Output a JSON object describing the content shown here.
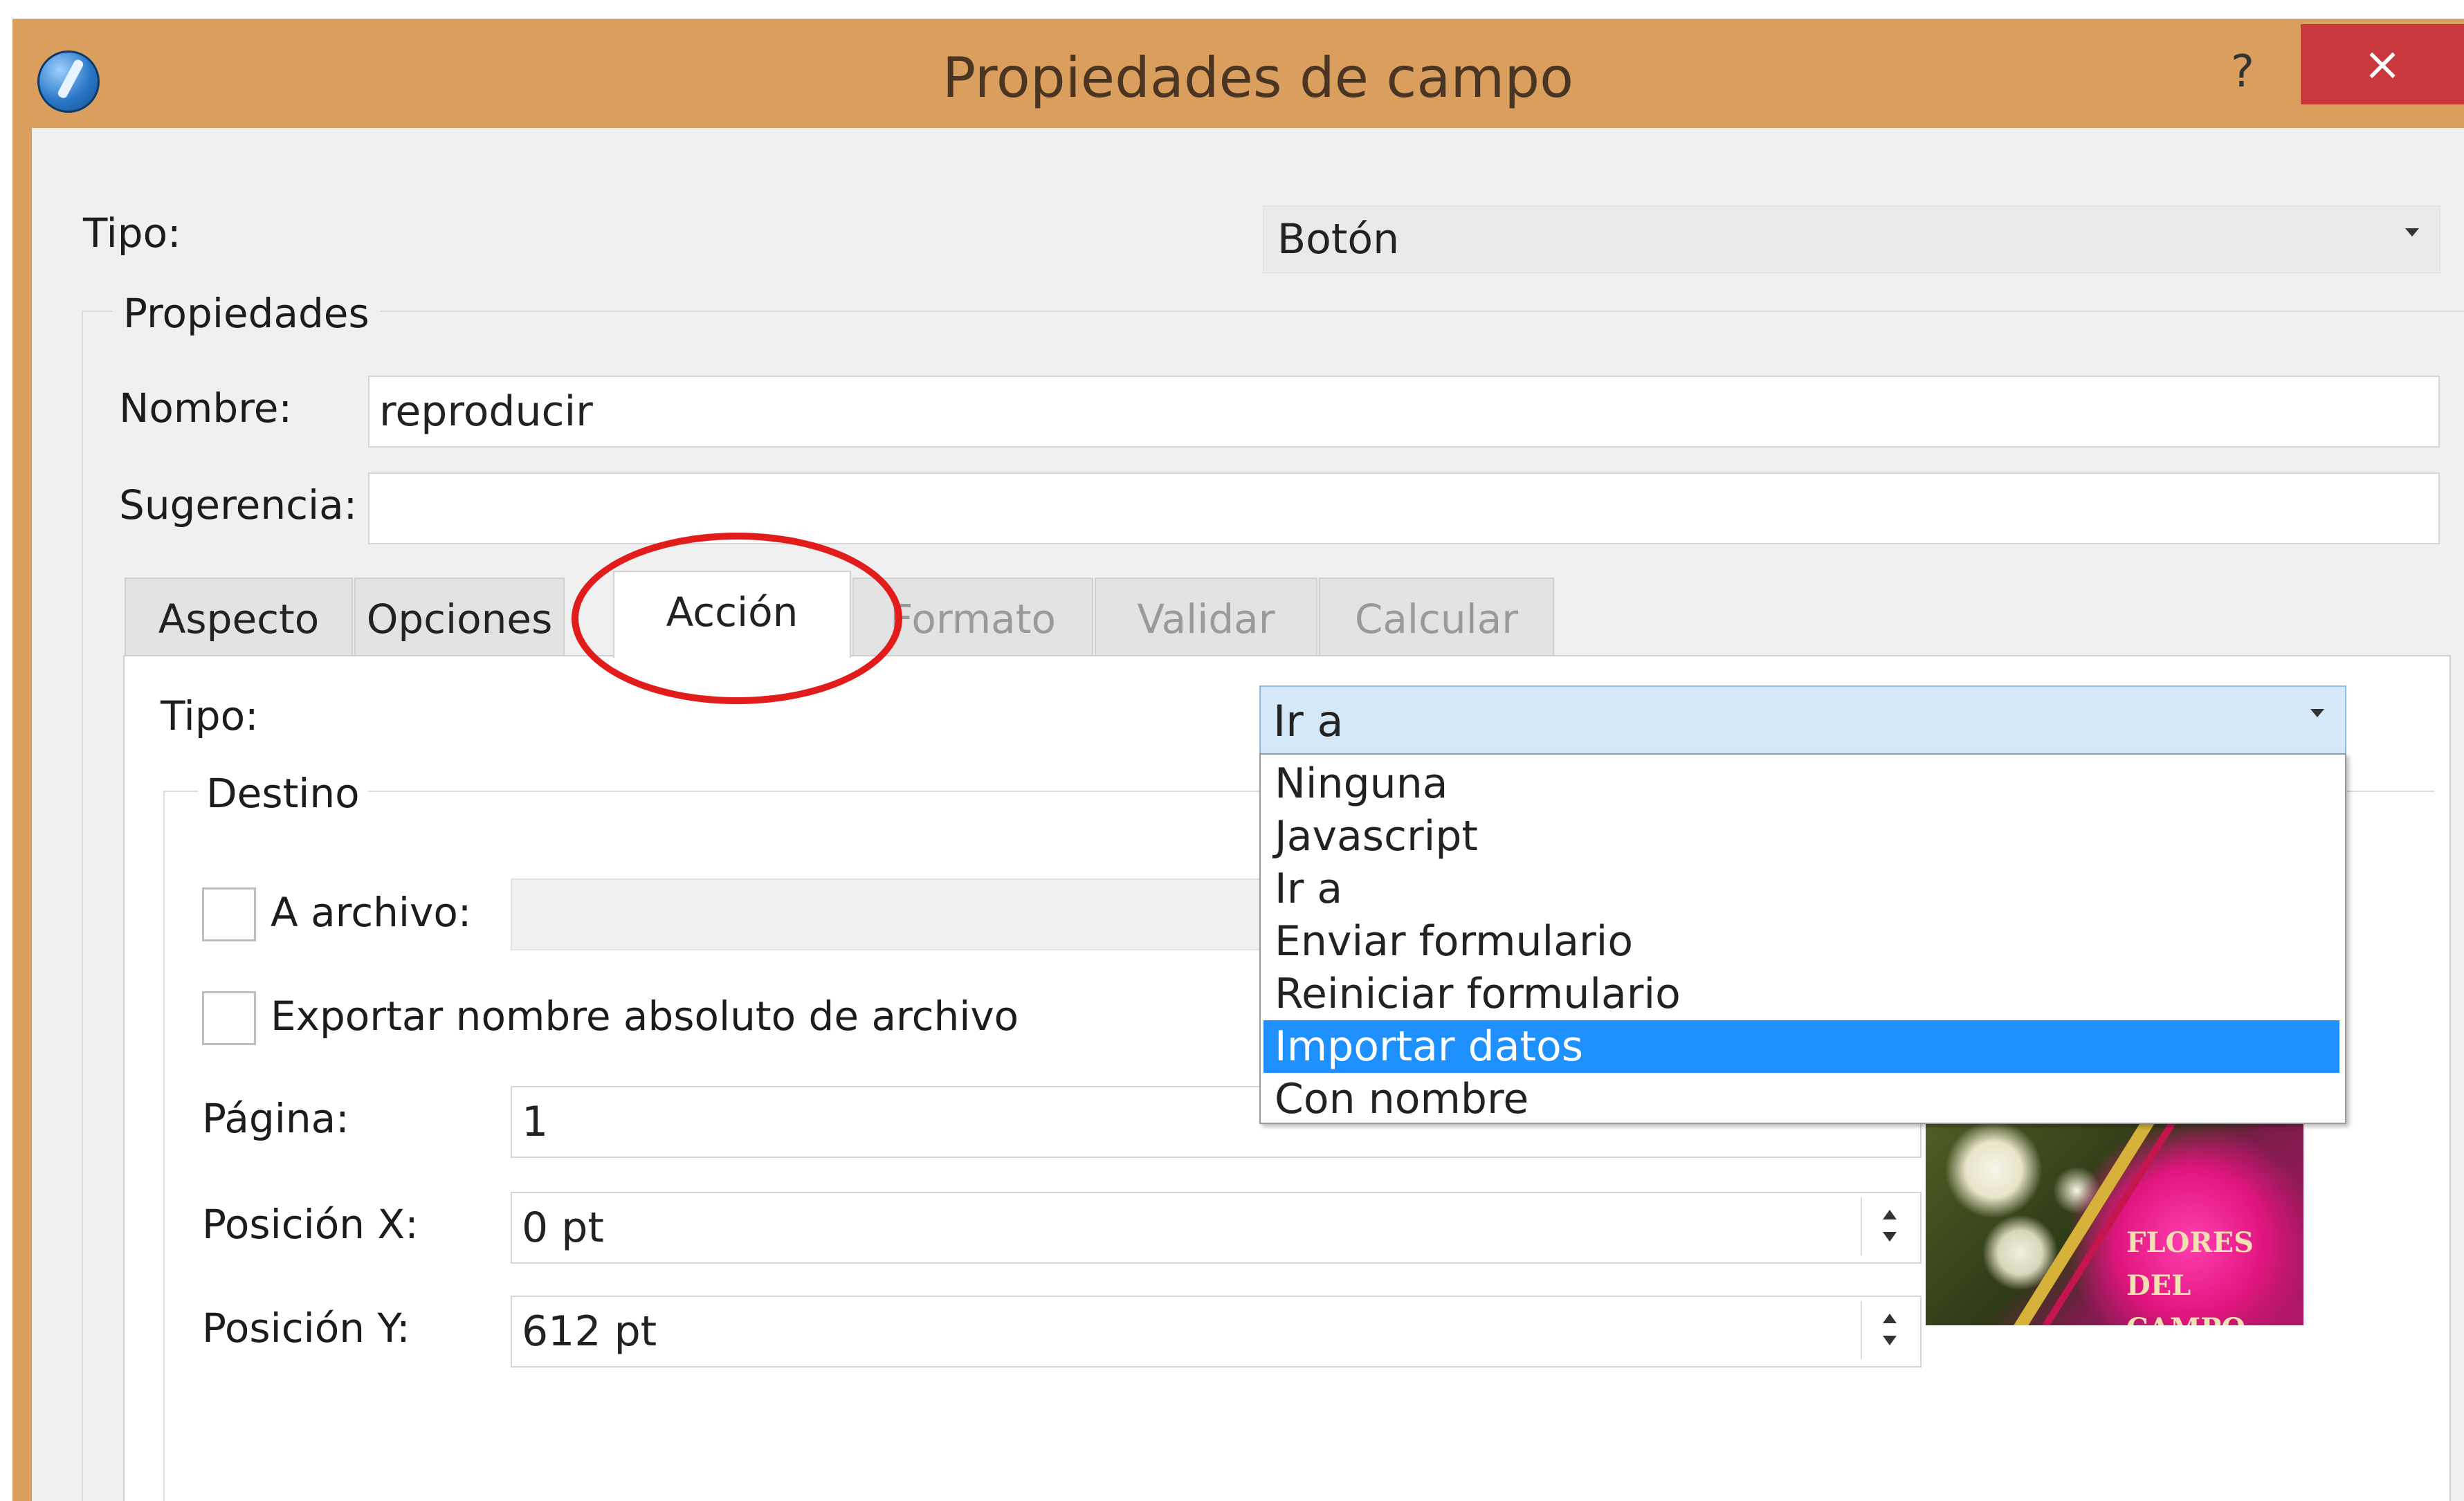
{
  "window": {
    "title": "Propiedades de campo",
    "help_label": "?",
    "close_label": "×"
  },
  "field": {
    "type_label": "Tipo:",
    "type_value": "Botón",
    "properties_title": "Propiedades",
    "name_label": "Nombre:",
    "name_value": "reproducir",
    "tooltip_label": "Sugerencia:",
    "tooltip_value": ""
  },
  "tabs": [
    {
      "label": "Aspecto",
      "state": "normal"
    },
    {
      "label": "Opciones",
      "state": "normal"
    },
    {
      "label": "Acción",
      "state": "active"
    },
    {
      "label": "Formato",
      "state": "disabled"
    },
    {
      "label": "Validar",
      "state": "disabled"
    },
    {
      "label": "Calcular",
      "state": "disabled"
    }
  ],
  "action": {
    "type_label": "Tipo:",
    "type_value": "Ir a",
    "options": [
      "Ninguna",
      "Javascript",
      "Ir a",
      "Enviar formulario",
      "Reiniciar formulario",
      "Importar datos",
      "Con nombre"
    ],
    "highlighted_option": "Importar datos",
    "destination_title": "Destino",
    "to_file_label": "A archivo:",
    "to_file_checked": false,
    "export_abs_label": "Exportar nombre absoluto de archivo",
    "export_abs_checked": false,
    "page_label": "Página:",
    "page_value": "1",
    "posx_label": "Posición X:",
    "posx_value": "0 pt",
    "posy_label": "Posición Y:",
    "posy_value": "612 pt"
  },
  "preview": {
    "text_lines": [
      "FLORES",
      "DEL",
      "CAMPO"
    ]
  },
  "colors": {
    "title_bar": "#da9f5f",
    "close_button": "#c8383c",
    "selection": "#1e90ff",
    "annotation": "#e21b1b"
  },
  "icons": [
    "app-icon",
    "help-icon",
    "close-icon",
    "chevron-down-icon",
    "spin-up-icon",
    "spin-down-icon"
  ]
}
